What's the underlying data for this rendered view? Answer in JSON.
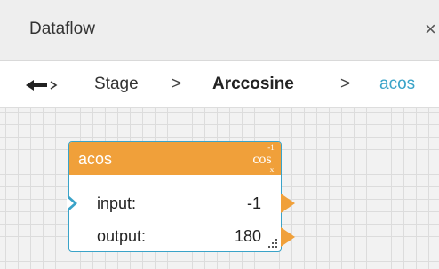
{
  "window": {
    "title": "Dataflow",
    "close_glyph": "×"
  },
  "breadcrumb": {
    "back_icon": "back-arrow-icon",
    "items": [
      "Stage",
      "Arccosine",
      "acos"
    ],
    "separator": ">"
  },
  "node": {
    "title": "acos",
    "func_icon": "arccosine-icon",
    "func_icon_text": {
      "sup": "-1",
      "main": "cos",
      "sub": "x"
    },
    "rows": [
      {
        "label": "input:",
        "value": "-1"
      },
      {
        "label": "output:",
        "value": "180"
      }
    ]
  },
  "colors": {
    "accent": "#3aa3c8",
    "node_header": "#f0a03a",
    "port_out": "#f0a03a",
    "titlebar_bg": "#eeeeee",
    "grid_bg": "#f2f2f2"
  }
}
